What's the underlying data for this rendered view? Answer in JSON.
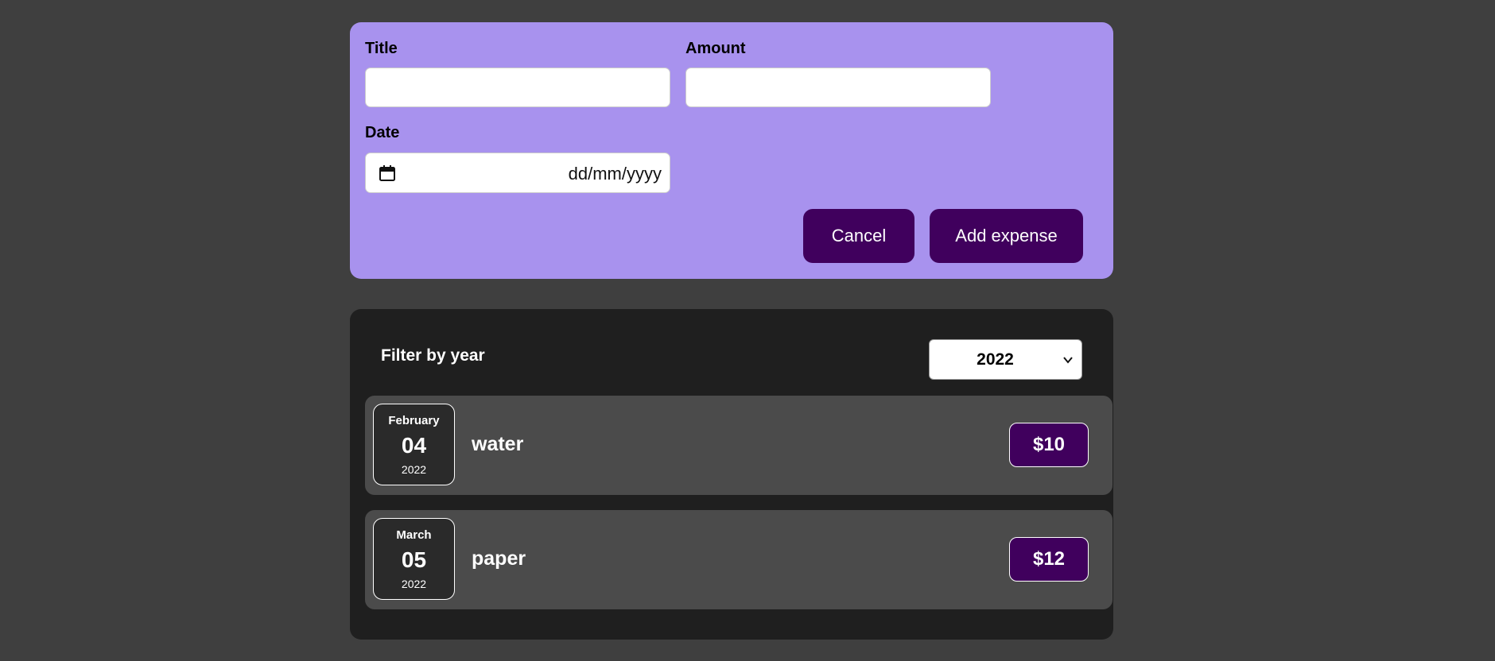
{
  "form": {
    "title_label": "Title",
    "title_value": "",
    "amount_label": "Amount",
    "amount_value": "",
    "date_label": "Date",
    "date_placeholder": "dd/mm/yyyy",
    "cancel_label": "Cancel",
    "submit_label": "Add expense",
    "bg_color": "#a892ee",
    "button_color": "#40005d"
  },
  "filter": {
    "label": "Filter by year",
    "selected_year": "2022"
  },
  "expenses": [
    {
      "month": "February",
      "day": "04",
      "year": "2022",
      "title": "water",
      "amount": "$10"
    },
    {
      "month": "March",
      "day": "05",
      "year": "2022",
      "title": "paper",
      "amount": "$12"
    }
  ],
  "icons": {
    "date": "calendar-icon",
    "select": "chevron-down-icon"
  }
}
